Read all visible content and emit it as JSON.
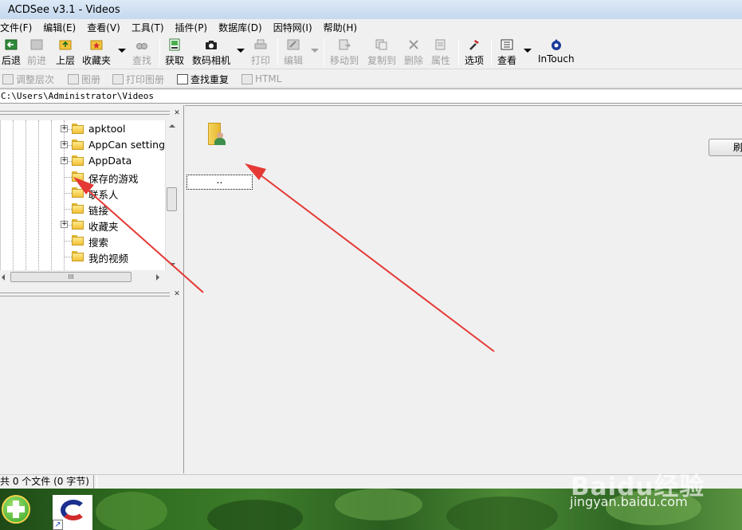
{
  "window": {
    "title": "ACDSee v3.1 - Videos"
  },
  "menu": [
    "文件(F)",
    "编辑(E)",
    "查看(V)",
    "工具(T)",
    "插件(P)",
    "数据库(D)",
    "因特网(I)",
    "帮助(H)"
  ],
  "toolbar": {
    "back": "后退",
    "forward": "前进",
    "up": "上层",
    "favorites": "收藏夹",
    "find": "查找",
    "acquire": "获取",
    "camera": "数码相机",
    "print": "打印",
    "edit": "编辑",
    "move_to": "移动到",
    "copy_to": "复制到",
    "delete": "删除",
    "properties": "属性",
    "options": "选项",
    "view": "查看",
    "intouch": "InTouch"
  },
  "toolbar2": {
    "adjust_layers": "调整层次",
    "album": "图册",
    "print_album": "打印图册",
    "find_duplicates": "查找重复",
    "html": "HTML"
  },
  "path": "C:\\Users\\Administrator\\Videos",
  "tree": {
    "items": [
      {
        "label": "apktool",
        "expander": "+"
      },
      {
        "label": "AppCan settings",
        "expander": "+"
      },
      {
        "label": "AppData",
        "expander": "+"
      },
      {
        "label": "保存的游戏",
        "expander": ""
      },
      {
        "label": "联系人",
        "expander": ""
      },
      {
        "label": "链接",
        "expander": ""
      },
      {
        "label": "收藏夹",
        "expander": "+"
      },
      {
        "label": "搜索",
        "expander": ""
      },
      {
        "label": "我的视频",
        "expander": ""
      }
    ],
    "hscroll_grip": "III"
  },
  "file_list": {
    "item_caption": "..",
    "refresh_label": "刷"
  },
  "status": {
    "summary": "共 0 个文件 (0 字节)"
  },
  "watermark": {
    "logo": "Baidu经验",
    "url": "jingyan.baidu.com"
  },
  "icons": {
    "back": "back-icon",
    "forward": "forward-icon",
    "up": "folder-up-icon",
    "favorites": "favorites-icon",
    "find": "binoculars-icon",
    "acquire": "scanner-icon",
    "camera": "camera-icon",
    "print": "printer-icon",
    "edit": "edit-icon",
    "move_to": "move-icon",
    "copy_to": "copy-icon",
    "delete": "delete-icon",
    "properties": "properties-icon",
    "options": "tools-icon",
    "view": "view-icon",
    "intouch": "intouch-icon"
  },
  "colors": {
    "annotation_arrow": "#e53935",
    "folder": "#f2c23a"
  }
}
